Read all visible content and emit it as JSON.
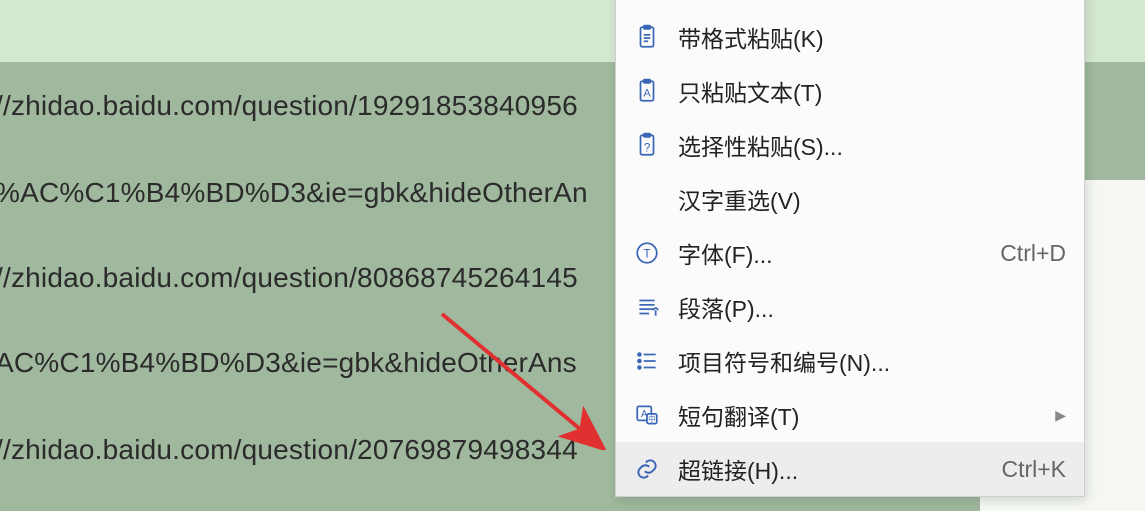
{
  "text_lines": {
    "l1": "//zhidao.baidu.com/question/19291853840956",
    "l2": "%AC%C1%B4%BD%D3&ie=gbk&hideOtherAn",
    "l3": "//zhidao.baidu.com/question/80868745264145",
    "l4": "AC%C1%B4%BD%D3&ie=gbk&hideOtherAns",
    "l5": "//zhidao.baidu.com/question/20769879498344"
  },
  "menu": {
    "paste_fmt": {
      "label": "带格式粘贴(K)"
    },
    "paste_text": {
      "label": "只粘贴文本(T)"
    },
    "paste_sel": {
      "label": "选择性粘贴(S)..."
    },
    "hanzi": {
      "label": "汉字重选(V)"
    },
    "font": {
      "label": "字体(F)...",
      "shortcut": "Ctrl+D"
    },
    "paragraph": {
      "label": "段落(P)..."
    },
    "bullets": {
      "label": "项目符号和编号(N)..."
    },
    "translate": {
      "label": "短句翻译(T)"
    },
    "hyperlink": {
      "label": "超链接(H)...",
      "shortcut": "Ctrl+K"
    }
  }
}
